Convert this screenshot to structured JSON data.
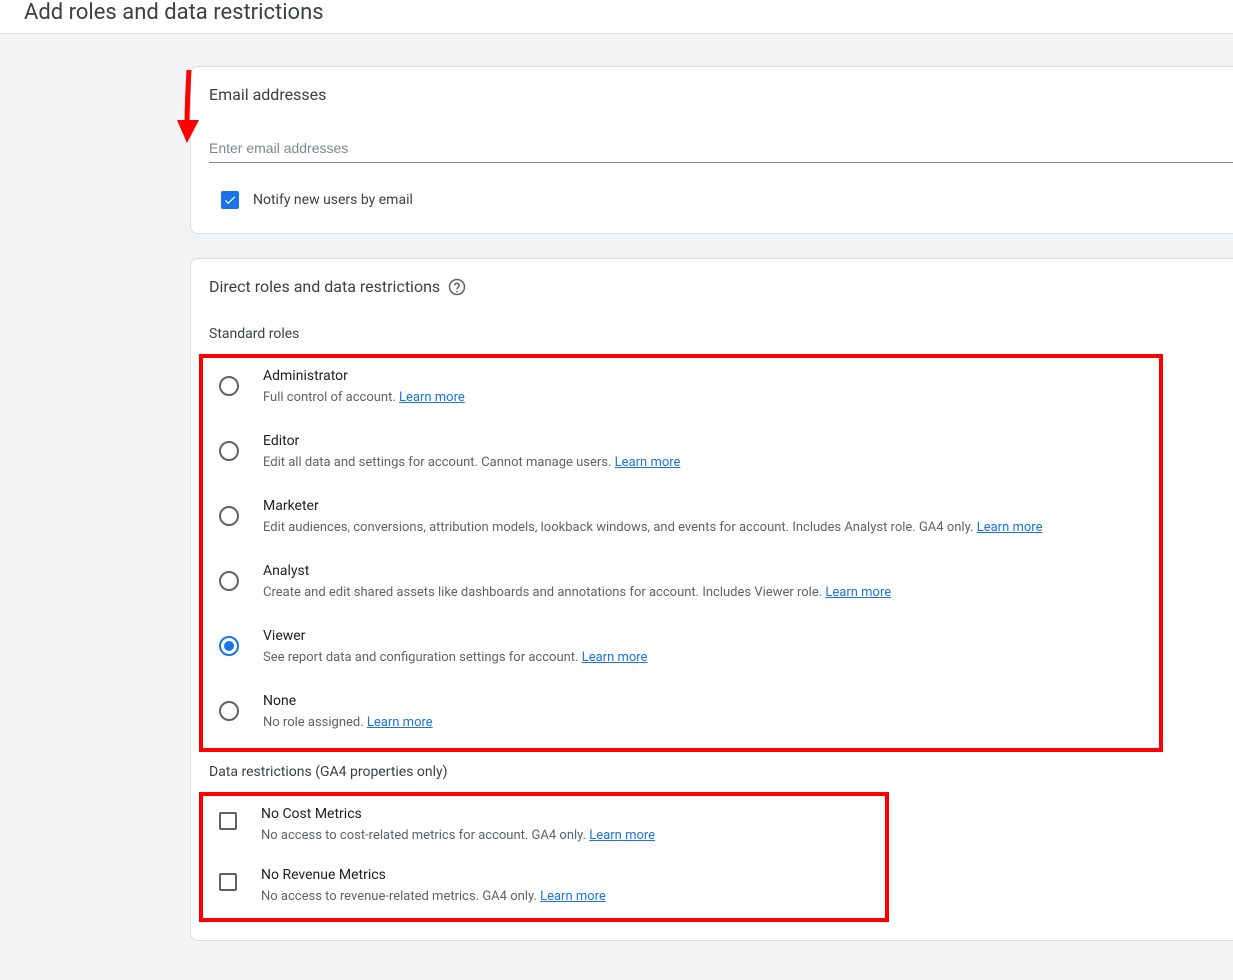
{
  "page_title": "Add roles and data restrictions",
  "email_section": {
    "title": "Email addresses",
    "placeholder": "Enter email addresses",
    "notify_label": "Notify new users by email",
    "notify_checked": true
  },
  "roles_section": {
    "title": "Direct roles and data restrictions",
    "standard_heading": "Standard roles",
    "learn_more_label": "Learn more",
    "roles": [
      {
        "id": "administrator",
        "name": "Administrator",
        "desc": "Full control of account. ",
        "selected": false
      },
      {
        "id": "editor",
        "name": "Editor",
        "desc": "Edit all data and settings for account. Cannot manage users. ",
        "selected": false
      },
      {
        "id": "marketer",
        "name": "Marketer",
        "desc": "Edit audiences, conversions, attribution models, lookback windows, and events for account. Includes Analyst role. GA4 only. ",
        "selected": false
      },
      {
        "id": "analyst",
        "name": "Analyst",
        "desc": "Create and edit shared assets like dashboards and annotations for account. Includes Viewer role. ",
        "selected": false
      },
      {
        "id": "viewer",
        "name": "Viewer",
        "desc": "See report data and configuration settings for account. ",
        "selected": true
      },
      {
        "id": "none",
        "name": "None",
        "desc": "No role assigned. ",
        "selected": false
      }
    ],
    "restrictions_heading": "Data restrictions (GA4 properties only)",
    "restrictions": [
      {
        "id": "no-cost",
        "name": "No Cost Metrics",
        "desc": "No access to cost-related metrics for account. GA4 only. ",
        "checked": false
      },
      {
        "id": "no-revenue",
        "name": "No Revenue Metrics",
        "desc": "No access to revenue-related metrics. GA4 only. ",
        "checked": false
      }
    ]
  }
}
